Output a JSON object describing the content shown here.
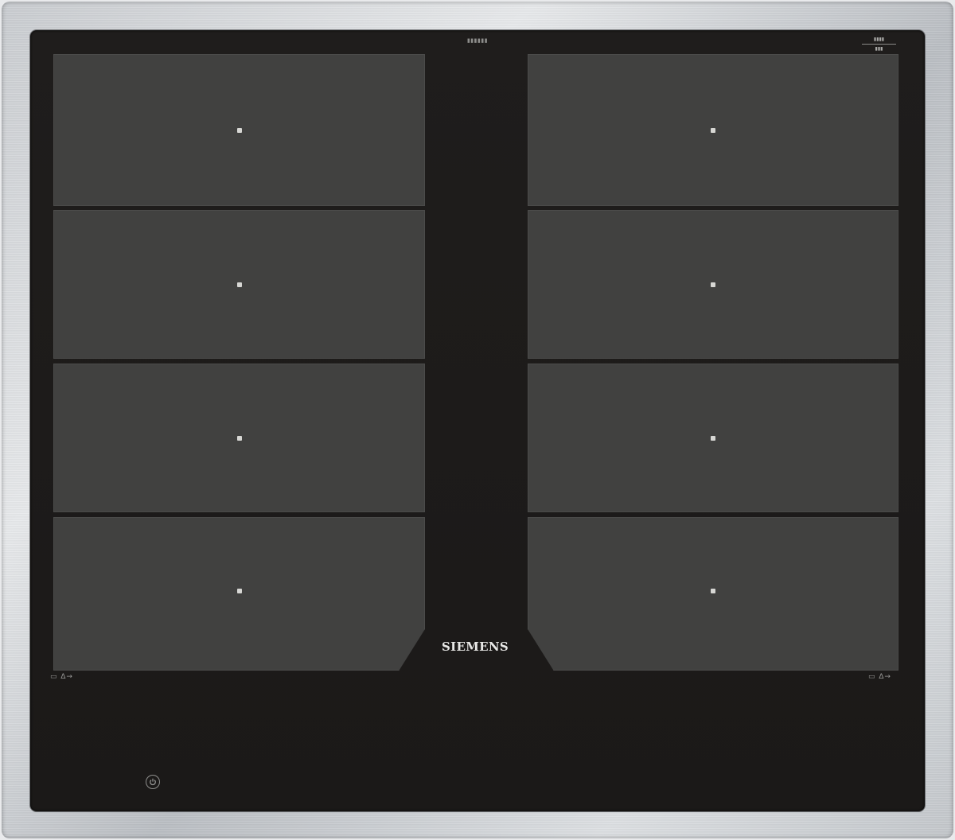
{
  "cooktop": {
    "brand": "SIEMENS",
    "model_code": "▮▮▮▮▮▮",
    "badge_text": [
      "▮▮▮▮",
      "▮▮▮"
    ],
    "zone_icons_left": "▭ ∆→",
    "zone_icons_right": "▭ ∆→",
    "power_icon": "power-icon",
    "colors": {
      "frame": "#c9ccd0",
      "glass": "#1d1b1a",
      "zone": "#414140",
      "zone_dot": "#d7d7d4",
      "logo": "#e8e8e6"
    },
    "zones_per_side": 4
  }
}
